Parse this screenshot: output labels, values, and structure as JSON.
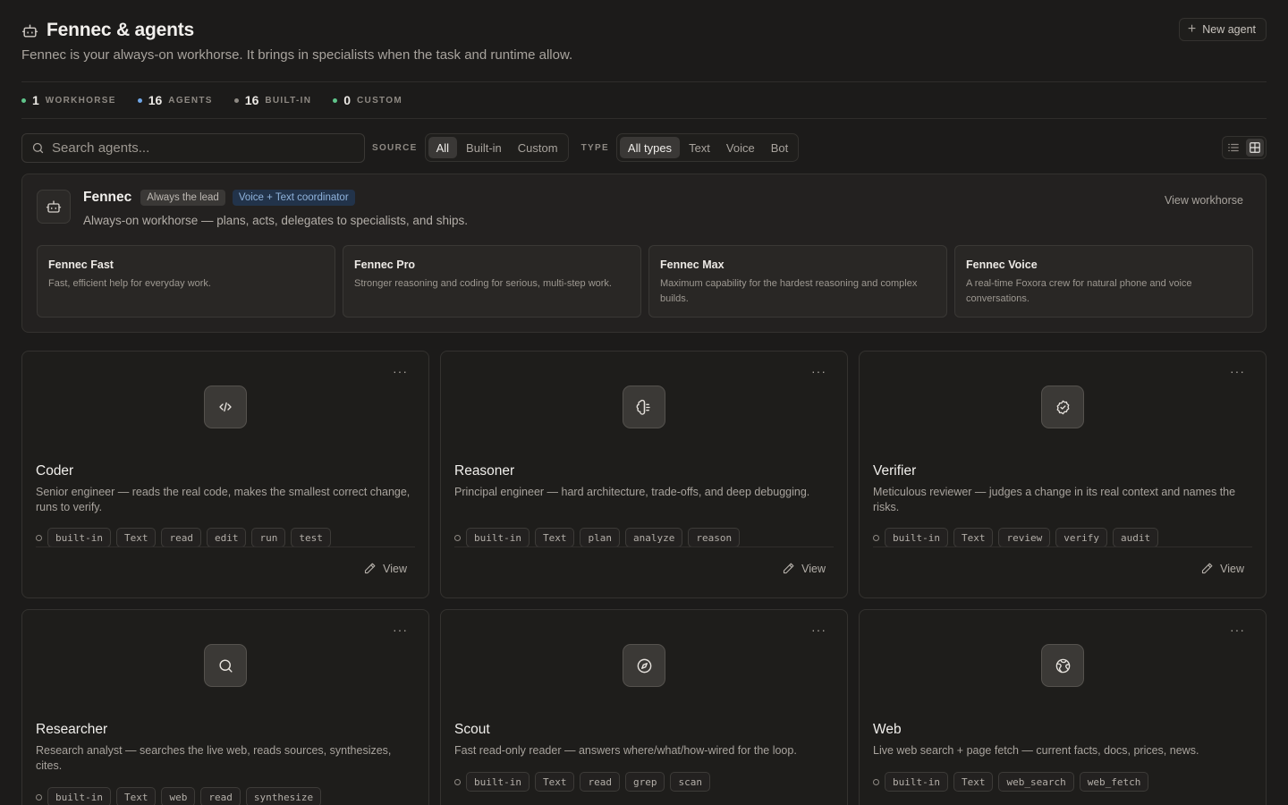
{
  "header": {
    "title": "Fennec & agents",
    "subtitle": "Fennec is your always-on workhorse. It brings in specialists when the task and runtime allow.",
    "new_agent_label": "New agent"
  },
  "stats": [
    {
      "value": "1",
      "label": "WORKHORSE",
      "color": "#5fc48a"
    },
    {
      "value": "16",
      "label": "AGENTS",
      "color": "#6fa6e6"
    },
    {
      "value": "16",
      "label": "BUILT-IN",
      "color": "#8e8983"
    },
    {
      "value": "0",
      "label": "CUSTOM",
      "color": "#5fc48a"
    }
  ],
  "toolbar": {
    "search_placeholder": "Search agents...",
    "source_label": "SOURCE",
    "source_options": [
      "All",
      "Built-in",
      "Custom"
    ],
    "source_selected": "All",
    "type_label": "TYPE",
    "type_options": [
      "All types",
      "Text",
      "Voice",
      "Bot"
    ],
    "type_selected": "All types",
    "view_mode": "grid"
  },
  "workhorse": {
    "name": "Fennec",
    "badges": [
      "Always the lead",
      "Voice + Text coordinator"
    ],
    "description": "Always-on workhorse — plans, acts, delegates to specialists, and ships.",
    "link_label": "View workhorse",
    "models": [
      {
        "name": "Fennec Fast",
        "description": "Fast, efficient help for everyday work."
      },
      {
        "name": "Fennec Pro",
        "description": "Stronger reasoning and coding for serious, multi-step work."
      },
      {
        "name": "Fennec Max",
        "description": "Maximum capability for the hardest reasoning and complex builds."
      },
      {
        "name": "Fennec Voice",
        "description": "A real-time Foxora crew for natural phone and voice conversations."
      }
    ]
  },
  "agents": [
    {
      "name": "Coder",
      "icon": "code-icon",
      "description": "Senior engineer — reads the real code, makes the smallest correct change, runs to verify.",
      "tags": [
        "built-in",
        "Text",
        "read",
        "edit",
        "run",
        "test"
      ],
      "view_label": "View"
    },
    {
      "name": "Reasoner",
      "icon": "brain-icon",
      "description": "Principal engineer — hard architecture, trade-offs, and deep debugging.",
      "tags": [
        "built-in",
        "Text",
        "plan",
        "analyze",
        "reason"
      ],
      "view_label": "View"
    },
    {
      "name": "Verifier",
      "icon": "check-badge-icon",
      "description": "Meticulous reviewer — judges a change in its real context and names the risks.",
      "tags": [
        "built-in",
        "Text",
        "review",
        "verify",
        "audit"
      ],
      "view_label": "View"
    },
    {
      "name": "Researcher",
      "icon": "search-icon",
      "description": "Research analyst — searches the live web, reads sources, synthesizes, cites.",
      "tags": [
        "built-in",
        "Text",
        "web",
        "read",
        "synthesize"
      ],
      "view_label": "View"
    },
    {
      "name": "Scout",
      "icon": "compass-icon",
      "description": "Fast read-only reader — answers where/what/how-wired for the loop.",
      "tags": [
        "built-in",
        "Text",
        "read",
        "grep",
        "scan"
      ],
      "view_label": "View"
    },
    {
      "name": "Web",
      "icon": "globe-icon",
      "description": "Live web search + page fetch — current facts, docs, prices, news.",
      "tags": [
        "built-in",
        "Text",
        "web_search",
        "web_fetch"
      ],
      "view_label": "View"
    }
  ]
}
